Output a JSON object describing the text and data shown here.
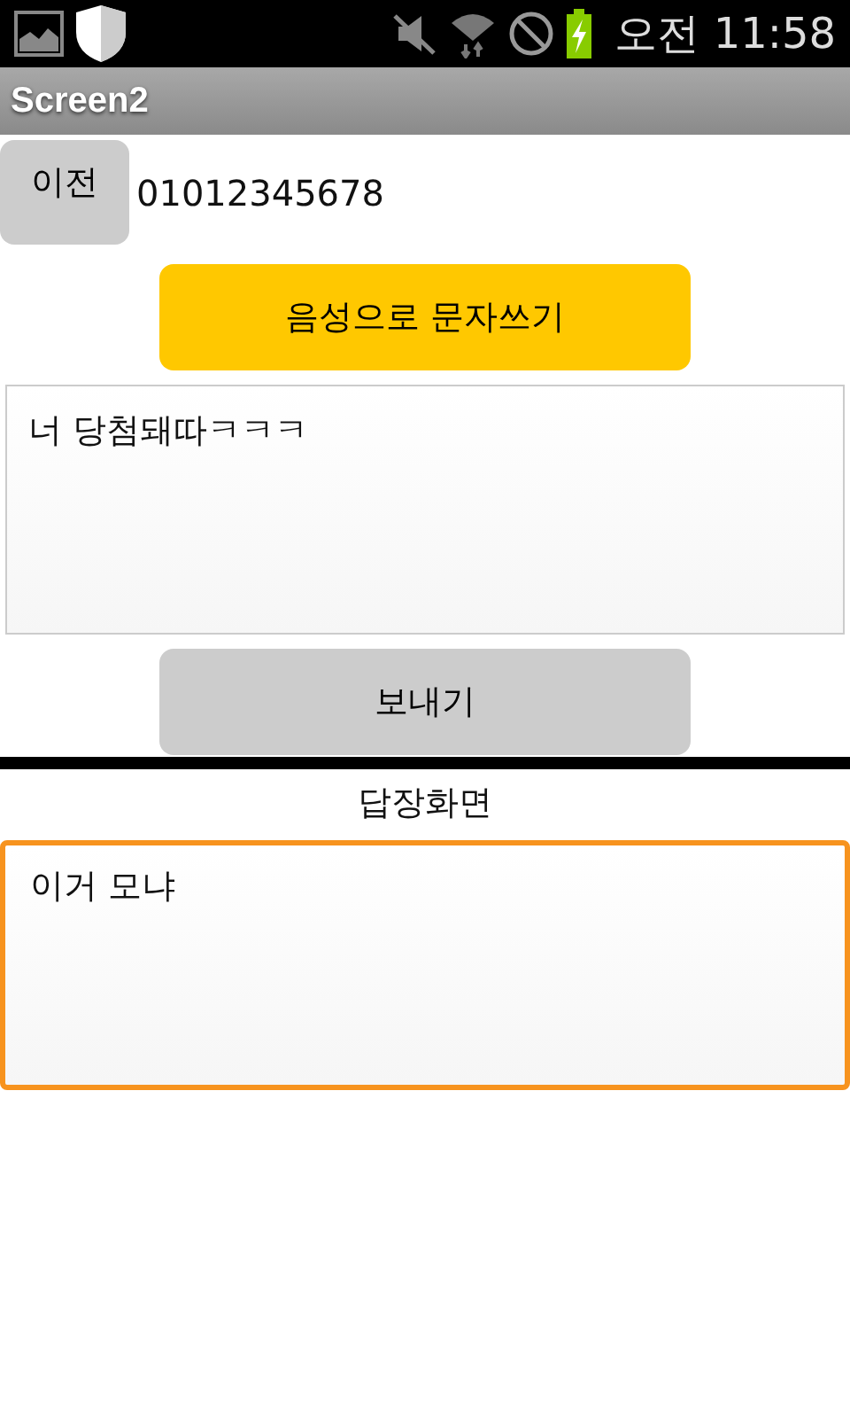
{
  "status_bar": {
    "time": "오전 11:58"
  },
  "title_bar": {
    "title": "Screen2"
  },
  "back_button": {
    "label": "이전"
  },
  "phone_number": "01012345678",
  "voice_button": {
    "label": "음성으로 문자쓰기"
  },
  "message_box": {
    "value": "너 당첨돼따ㅋㅋㅋ",
    "focused": false
  },
  "send_button": {
    "label": "보내기"
  },
  "reply_label": "답장화면",
  "reply_box": {
    "value": "이거 모냐",
    "focused": true
  }
}
